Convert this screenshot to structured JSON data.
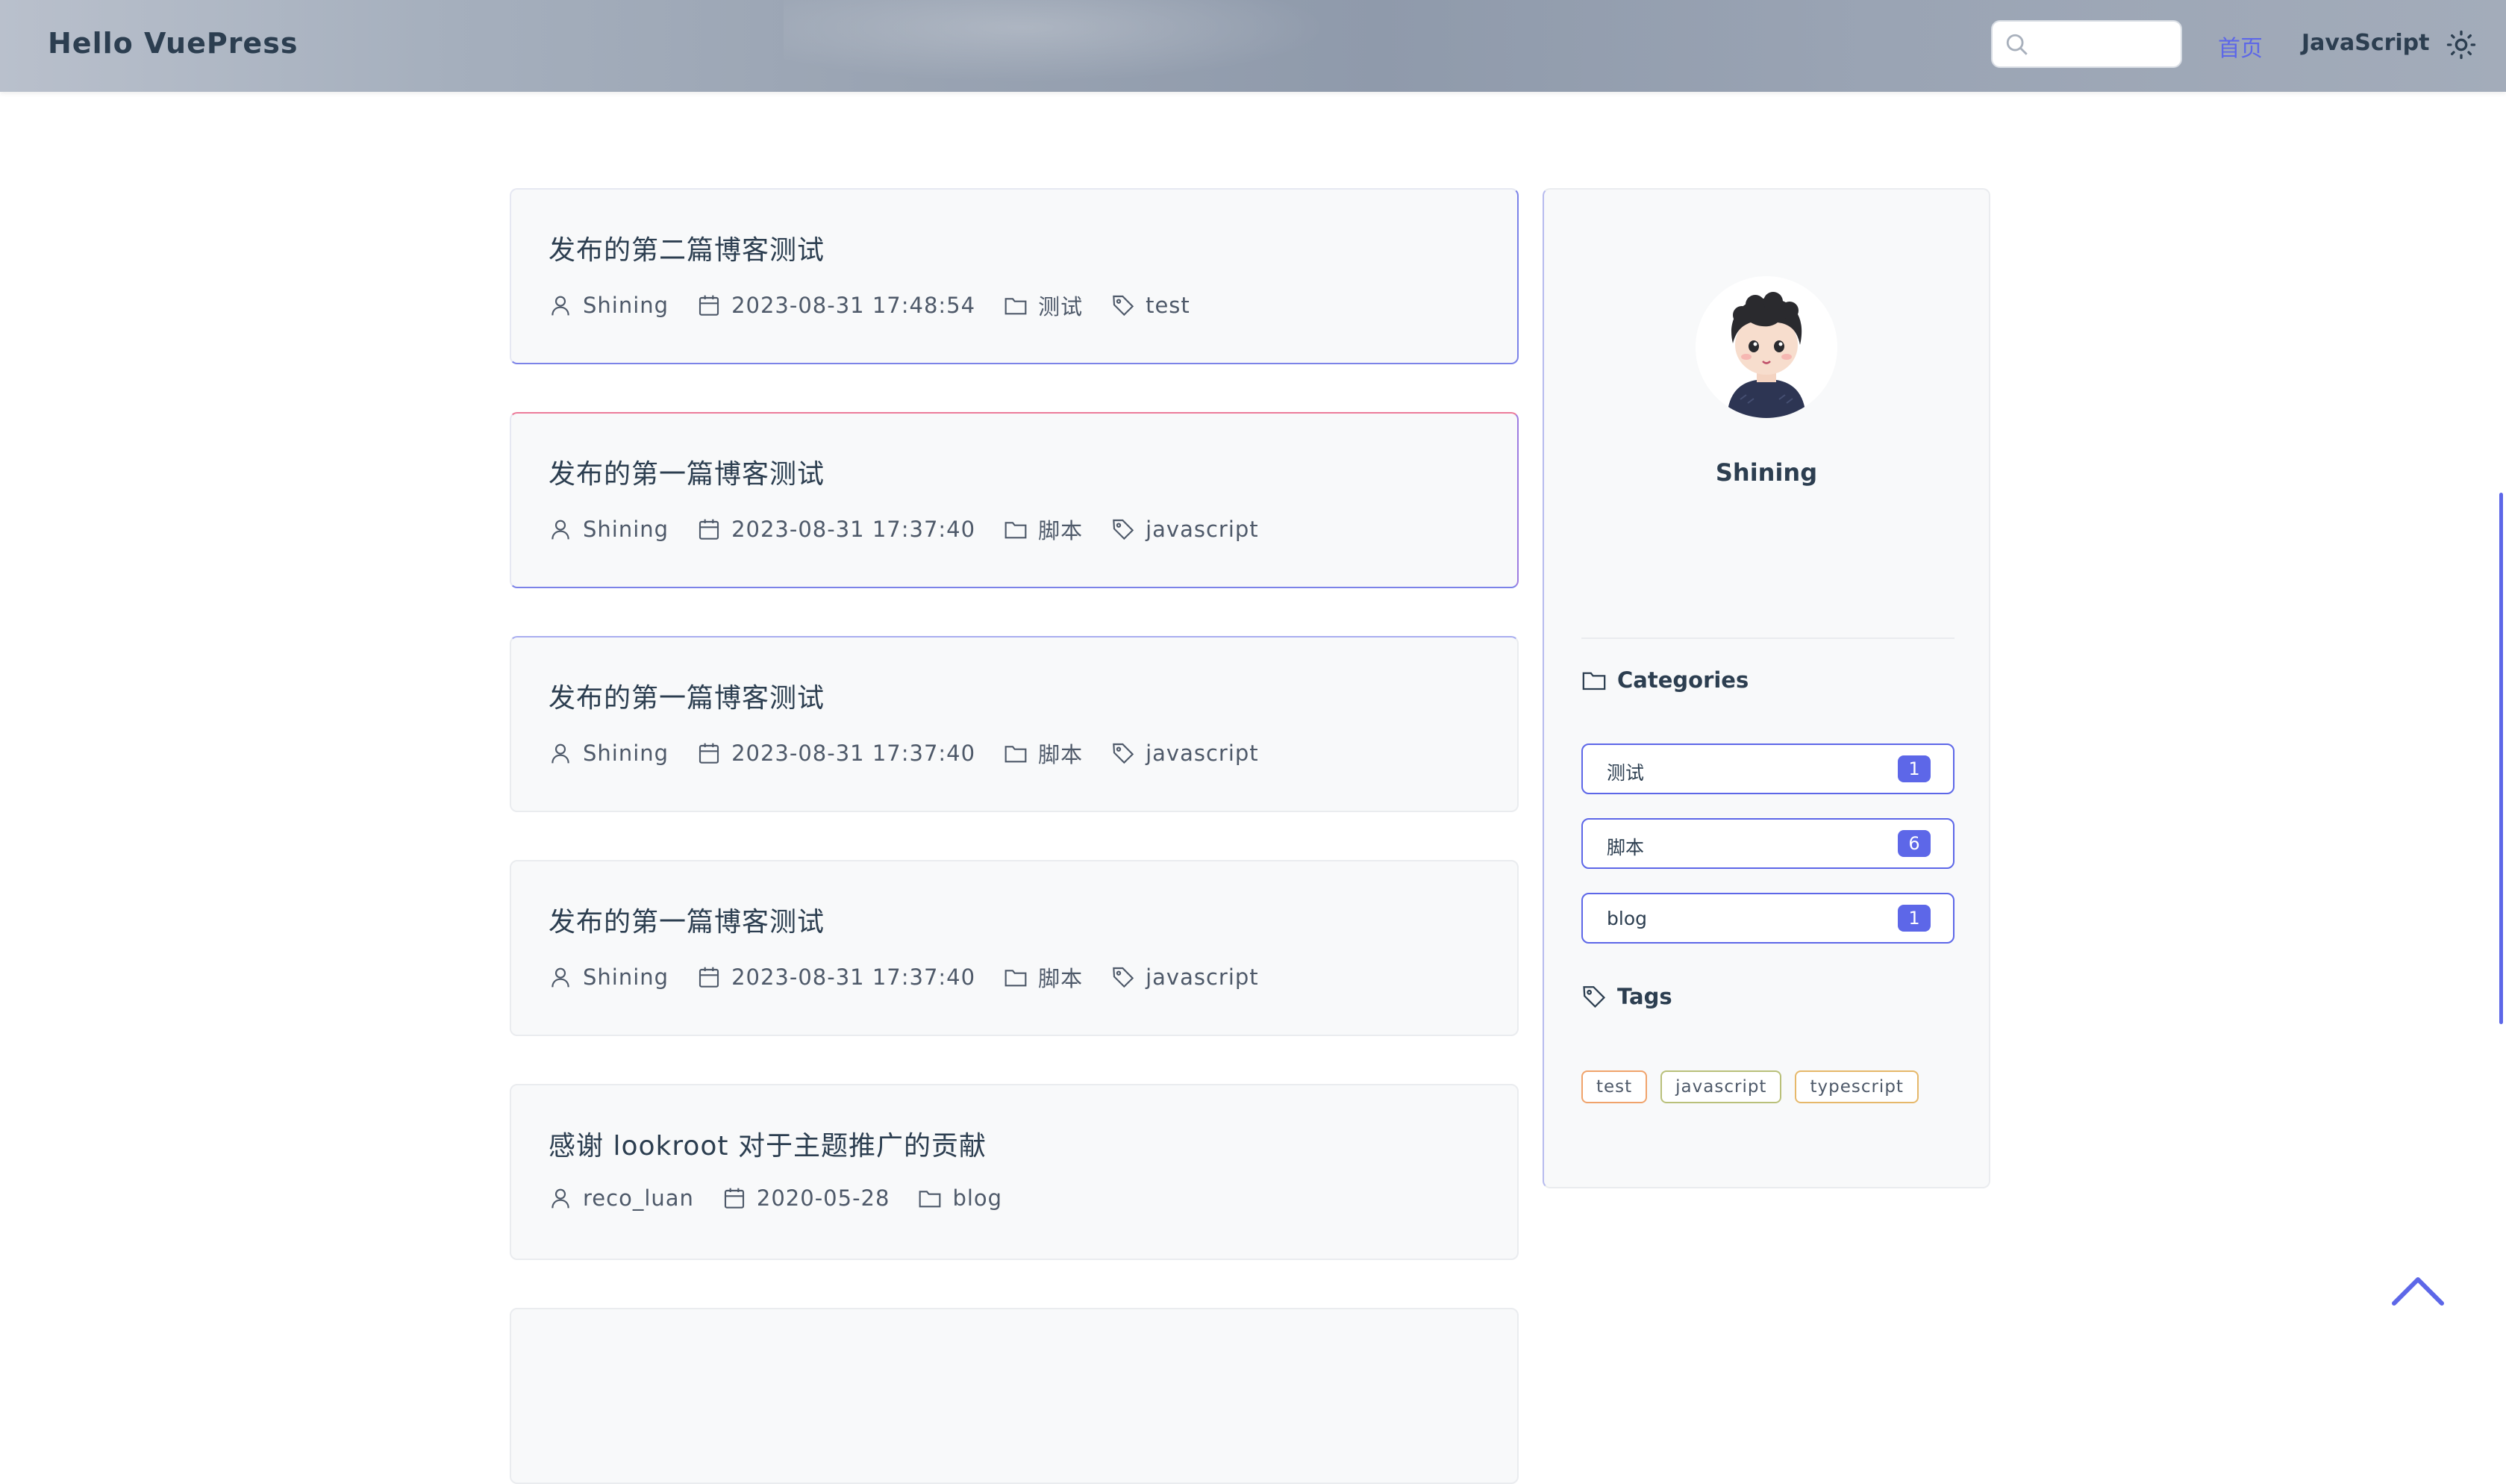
{
  "navbar": {
    "site_title": "Hello VuePress",
    "search_placeholder": "",
    "links": [
      {
        "label": "首页",
        "active": true
      },
      {
        "label": "JavaScript",
        "active": false
      }
    ]
  },
  "posts": [
    {
      "title": "发布的第二篇博客测试",
      "author": "Shining",
      "date": "2023-08-31 17:48:54",
      "category": "测试",
      "tag": "test"
    },
    {
      "title": "发布的第一篇博客测试",
      "author": "Shining",
      "date": "2023-08-31 17:37:40",
      "category": "脚本",
      "tag": "javascript"
    },
    {
      "title": "发布的第一篇博客测试",
      "author": "Shining",
      "date": "2023-08-31 17:37:40",
      "category": "脚本",
      "tag": "javascript"
    },
    {
      "title": "发布的第一篇博客测试",
      "author": "Shining",
      "date": "2023-08-31 17:37:40",
      "category": "脚本",
      "tag": "javascript"
    },
    {
      "title": "感谢 lookroot 对于主题推广的贡献",
      "author": "reco_luan",
      "date": "2020-05-28",
      "category": "blog"
    }
  ],
  "sidebar": {
    "author_name": "Shining",
    "categories_heading": "Categories",
    "categories": [
      {
        "label": "测试",
        "count": "1"
      },
      {
        "label": "脚本",
        "count": "6"
      },
      {
        "label": "blog",
        "count": "1"
      }
    ],
    "tags_heading": "Tags",
    "tags": [
      {
        "label": "test",
        "color": "#f0a36b"
      },
      {
        "label": "javascript",
        "color": "#b9c07a"
      },
      {
        "label": "typescript",
        "color": "#e6b86a"
      }
    ]
  },
  "colors": {
    "accent": "#5d67e8"
  }
}
